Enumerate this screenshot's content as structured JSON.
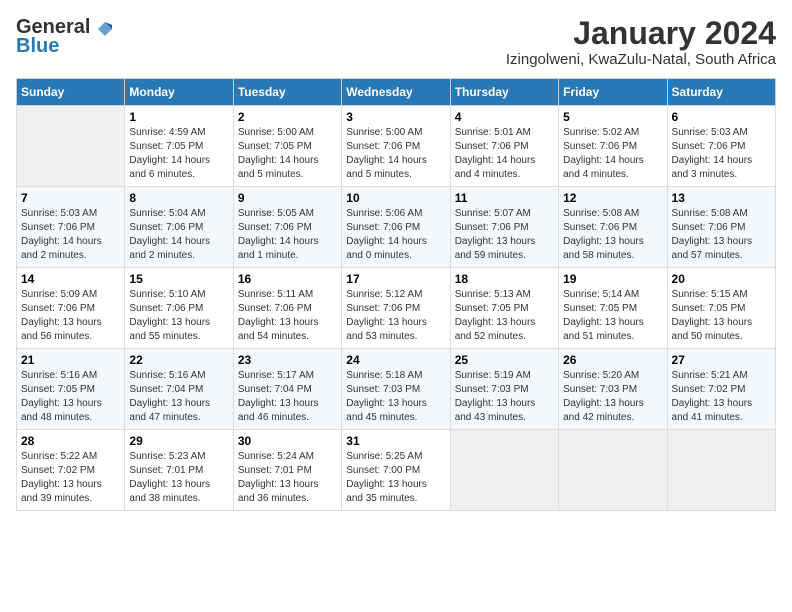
{
  "logo": {
    "general": "General",
    "blue": "Blue"
  },
  "title": "January 2024",
  "location": "Izingolweni, KwaZulu-Natal, South Africa",
  "days_of_week": [
    "Sunday",
    "Monday",
    "Tuesday",
    "Wednesday",
    "Thursday",
    "Friday",
    "Saturday"
  ],
  "weeks": [
    [
      {
        "day": "",
        "info": ""
      },
      {
        "day": "1",
        "info": "Sunrise: 4:59 AM\nSunset: 7:05 PM\nDaylight: 14 hours\nand 6 minutes."
      },
      {
        "day": "2",
        "info": "Sunrise: 5:00 AM\nSunset: 7:05 PM\nDaylight: 14 hours\nand 5 minutes."
      },
      {
        "day": "3",
        "info": "Sunrise: 5:00 AM\nSunset: 7:06 PM\nDaylight: 14 hours\nand 5 minutes."
      },
      {
        "day": "4",
        "info": "Sunrise: 5:01 AM\nSunset: 7:06 PM\nDaylight: 14 hours\nand 4 minutes."
      },
      {
        "day": "5",
        "info": "Sunrise: 5:02 AM\nSunset: 7:06 PM\nDaylight: 14 hours\nand 4 minutes."
      },
      {
        "day": "6",
        "info": "Sunrise: 5:03 AM\nSunset: 7:06 PM\nDaylight: 14 hours\nand 3 minutes."
      }
    ],
    [
      {
        "day": "7",
        "info": "Sunrise: 5:03 AM\nSunset: 7:06 PM\nDaylight: 14 hours\nand 2 minutes."
      },
      {
        "day": "8",
        "info": "Sunrise: 5:04 AM\nSunset: 7:06 PM\nDaylight: 14 hours\nand 2 minutes."
      },
      {
        "day": "9",
        "info": "Sunrise: 5:05 AM\nSunset: 7:06 PM\nDaylight: 14 hours\nand 1 minute."
      },
      {
        "day": "10",
        "info": "Sunrise: 5:06 AM\nSunset: 7:06 PM\nDaylight: 14 hours\nand 0 minutes."
      },
      {
        "day": "11",
        "info": "Sunrise: 5:07 AM\nSunset: 7:06 PM\nDaylight: 13 hours\nand 59 minutes."
      },
      {
        "day": "12",
        "info": "Sunrise: 5:08 AM\nSunset: 7:06 PM\nDaylight: 13 hours\nand 58 minutes."
      },
      {
        "day": "13",
        "info": "Sunrise: 5:08 AM\nSunset: 7:06 PM\nDaylight: 13 hours\nand 57 minutes."
      }
    ],
    [
      {
        "day": "14",
        "info": "Sunrise: 5:09 AM\nSunset: 7:06 PM\nDaylight: 13 hours\nand 56 minutes."
      },
      {
        "day": "15",
        "info": "Sunrise: 5:10 AM\nSunset: 7:06 PM\nDaylight: 13 hours\nand 55 minutes."
      },
      {
        "day": "16",
        "info": "Sunrise: 5:11 AM\nSunset: 7:06 PM\nDaylight: 13 hours\nand 54 minutes."
      },
      {
        "day": "17",
        "info": "Sunrise: 5:12 AM\nSunset: 7:06 PM\nDaylight: 13 hours\nand 53 minutes."
      },
      {
        "day": "18",
        "info": "Sunrise: 5:13 AM\nSunset: 7:05 PM\nDaylight: 13 hours\nand 52 minutes."
      },
      {
        "day": "19",
        "info": "Sunrise: 5:14 AM\nSunset: 7:05 PM\nDaylight: 13 hours\nand 51 minutes."
      },
      {
        "day": "20",
        "info": "Sunrise: 5:15 AM\nSunset: 7:05 PM\nDaylight: 13 hours\nand 50 minutes."
      }
    ],
    [
      {
        "day": "21",
        "info": "Sunrise: 5:16 AM\nSunset: 7:05 PM\nDaylight: 13 hours\nand 48 minutes."
      },
      {
        "day": "22",
        "info": "Sunrise: 5:16 AM\nSunset: 7:04 PM\nDaylight: 13 hours\nand 47 minutes."
      },
      {
        "day": "23",
        "info": "Sunrise: 5:17 AM\nSunset: 7:04 PM\nDaylight: 13 hours\nand 46 minutes."
      },
      {
        "day": "24",
        "info": "Sunrise: 5:18 AM\nSunset: 7:03 PM\nDaylight: 13 hours\nand 45 minutes."
      },
      {
        "day": "25",
        "info": "Sunrise: 5:19 AM\nSunset: 7:03 PM\nDaylight: 13 hours\nand 43 minutes."
      },
      {
        "day": "26",
        "info": "Sunrise: 5:20 AM\nSunset: 7:03 PM\nDaylight: 13 hours\nand 42 minutes."
      },
      {
        "day": "27",
        "info": "Sunrise: 5:21 AM\nSunset: 7:02 PM\nDaylight: 13 hours\nand 41 minutes."
      }
    ],
    [
      {
        "day": "28",
        "info": "Sunrise: 5:22 AM\nSunset: 7:02 PM\nDaylight: 13 hours\nand 39 minutes."
      },
      {
        "day": "29",
        "info": "Sunrise: 5:23 AM\nSunset: 7:01 PM\nDaylight: 13 hours\nand 38 minutes."
      },
      {
        "day": "30",
        "info": "Sunrise: 5:24 AM\nSunset: 7:01 PM\nDaylight: 13 hours\nand 36 minutes."
      },
      {
        "day": "31",
        "info": "Sunrise: 5:25 AM\nSunset: 7:00 PM\nDaylight: 13 hours\nand 35 minutes."
      },
      {
        "day": "",
        "info": ""
      },
      {
        "day": "",
        "info": ""
      },
      {
        "day": "",
        "info": ""
      }
    ]
  ]
}
